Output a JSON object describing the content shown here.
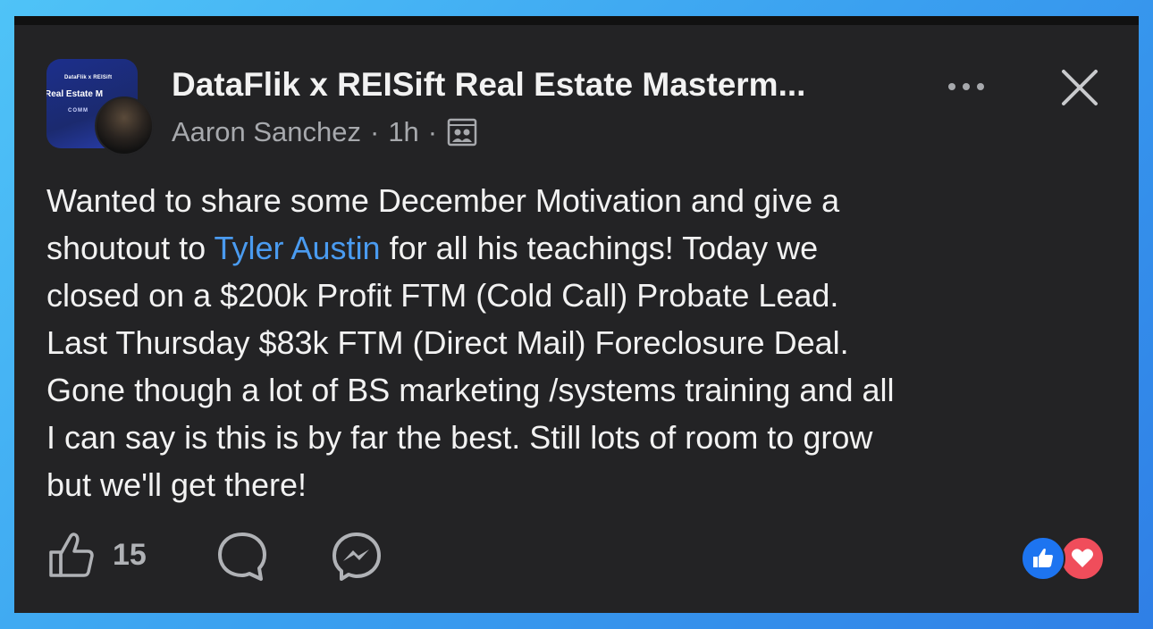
{
  "group_thumbnail": {
    "brand": "DataFlik x REISift",
    "title": "Real Estate M",
    "subtitle": "COMM"
  },
  "header": {
    "title": "DataFlik x REISift Real Estate Masterm...",
    "author": "Aaron Sanchez",
    "time": "1h",
    "separator": "·"
  },
  "post": {
    "lines": [
      {
        "text": "Wanted to share some December Motivation and give a"
      },
      {
        "before": "shoutout to ",
        "mention": "Tyler Austin",
        "after": " for all his teachings! Today we"
      },
      {
        "text": "closed on a $200k Profit FTM (Cold Call) Probate Lead."
      },
      {
        "text": "Last Thursday $83k FTM (Direct Mail) Foreclosure Deal."
      },
      {
        "text": "Gone though a lot of BS marketing /systems training and all"
      },
      {
        "text": "I can say is this is by far the best. Still lots of room to grow"
      },
      {
        "text": "but we'll get there!"
      }
    ]
  },
  "actions": {
    "like_count": "15"
  },
  "colors": {
    "card_bg": "#232325",
    "mention": "#4a9bf0",
    "like_reaction": "#1d74f0",
    "love_reaction": "#f04d5b"
  },
  "icons": [
    "more-icon",
    "close-icon",
    "group-visibility-icon",
    "like-icon",
    "comment-icon",
    "messenger-icon",
    "like-reaction-icon",
    "love-reaction-icon"
  ]
}
